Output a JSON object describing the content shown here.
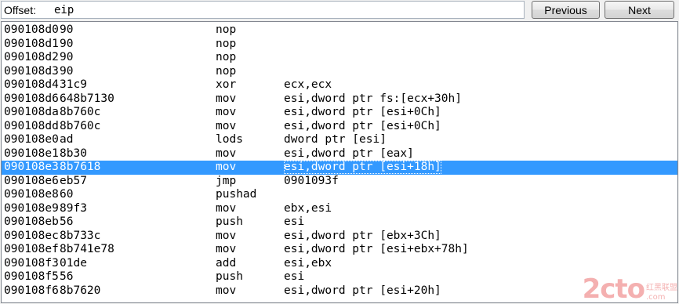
{
  "toolbar": {
    "offset_label": "Offset:",
    "offset_value": "eip",
    "previous_label": "Previous",
    "next_label": "Next"
  },
  "listing": {
    "rows": [
      {
        "addr": "090108d0",
        "bytes": "90",
        "mnem": "nop",
        "ops": ""
      },
      {
        "addr": "090108d1",
        "bytes": "90",
        "mnem": "nop",
        "ops": ""
      },
      {
        "addr": "090108d2",
        "bytes": "90",
        "mnem": "nop",
        "ops": ""
      },
      {
        "addr": "090108d3",
        "bytes": "90",
        "mnem": "nop",
        "ops": ""
      },
      {
        "addr": "090108d4",
        "bytes": "31c9",
        "mnem": "xor",
        "ops": "ecx,ecx"
      },
      {
        "addr": "090108d6",
        "bytes": "648b7130",
        "mnem": "mov",
        "ops": "esi,dword ptr fs:[ecx+30h]"
      },
      {
        "addr": "090108da",
        "bytes": "8b760c",
        "mnem": "mov",
        "ops": "esi,dword ptr [esi+0Ch]"
      },
      {
        "addr": "090108dd",
        "bytes": "8b760c",
        "mnem": "mov",
        "ops": "esi,dword ptr [esi+0Ch]"
      },
      {
        "addr": "090108e0",
        "bytes": "ad",
        "mnem": "lods",
        "ops": "dword ptr [esi]"
      },
      {
        "addr": "090108e1",
        "bytes": "8b30",
        "mnem": "mov",
        "ops": "esi,dword ptr [eax]"
      },
      {
        "addr": "090108e3",
        "bytes": "8b7618",
        "mnem": "mov",
        "ops": "esi,dword ptr [esi+18h]"
      },
      {
        "addr": "090108e6",
        "bytes": "eb57",
        "mnem": "jmp",
        "ops": "0901093f"
      },
      {
        "addr": "090108e8",
        "bytes": "60",
        "mnem": "pushad",
        "ops": ""
      },
      {
        "addr": "090108e9",
        "bytes": "89f3",
        "mnem": "mov",
        "ops": "ebx,esi"
      },
      {
        "addr": "090108eb",
        "bytes": "56",
        "mnem": "push",
        "ops": "esi"
      },
      {
        "addr": "090108ec",
        "bytes": "8b733c",
        "mnem": "mov",
        "ops": "esi,dword ptr [ebx+3Ch]"
      },
      {
        "addr": "090108ef",
        "bytes": "8b741e78",
        "mnem": "mov",
        "ops": "esi,dword ptr [esi+ebx+78h]"
      },
      {
        "addr": "090108f3",
        "bytes": "01de",
        "mnem": "add",
        "ops": "esi,ebx"
      },
      {
        "addr": "090108f5",
        "bytes": "56",
        "mnem": "push",
        "ops": "esi"
      },
      {
        "addr": "090108f6",
        "bytes": "8b7620",
        "mnem": "mov",
        "ops": "esi,dword ptr [esi+20h]"
      }
    ],
    "selected_index": 10,
    "selection_color": "#3399ff"
  },
  "watermark": {
    "logo": "2cto",
    "suffix": ".com",
    "tagline": "红黑联盟"
  }
}
